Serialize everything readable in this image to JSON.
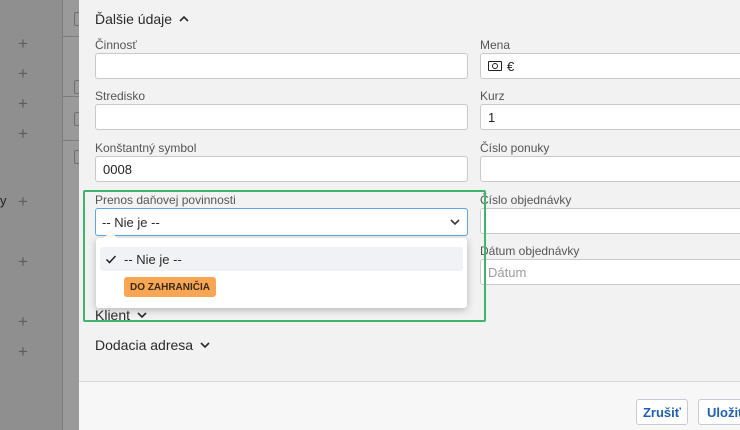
{
  "background": {
    "row_letter": "y"
  },
  "sections": {
    "additional": "Ďalšie údaje",
    "client": "Klient",
    "delivery": "Dodacia adresa"
  },
  "fields": {
    "cinnost": {
      "label": "Činnosť",
      "value": ""
    },
    "mena": {
      "label": "Mena",
      "value": "€",
      "icon": "money-icon"
    },
    "stredisko": {
      "label": "Stredisko",
      "value": ""
    },
    "kurz": {
      "label": "Kurz",
      "value": "1"
    },
    "konst": {
      "label": "Konštantný symbol",
      "value": "0008"
    },
    "ponuka": {
      "label": "Číslo ponuky",
      "value": ""
    },
    "prenos": {
      "label": "Prenos daňovej povinnosti",
      "value": "-- Nie je --"
    },
    "objednavka": {
      "label": "Číslo objednávky",
      "value": ""
    },
    "datum": {
      "label": "Dátum objednávky",
      "placeholder": "Dátum"
    }
  },
  "dropdown": {
    "options": [
      {
        "label": "-- Nie je --",
        "selected": true
      },
      {
        "label": "DO ZAHRANIČIA",
        "badge_color": "#f7a654"
      }
    ]
  },
  "buttons": {
    "cancel": "Zrušiť",
    "save": "Uložiť"
  },
  "colors": {
    "accent": "#1f5fb3",
    "focus": "#5fa4e6",
    "highlight": "#3fb46b"
  }
}
